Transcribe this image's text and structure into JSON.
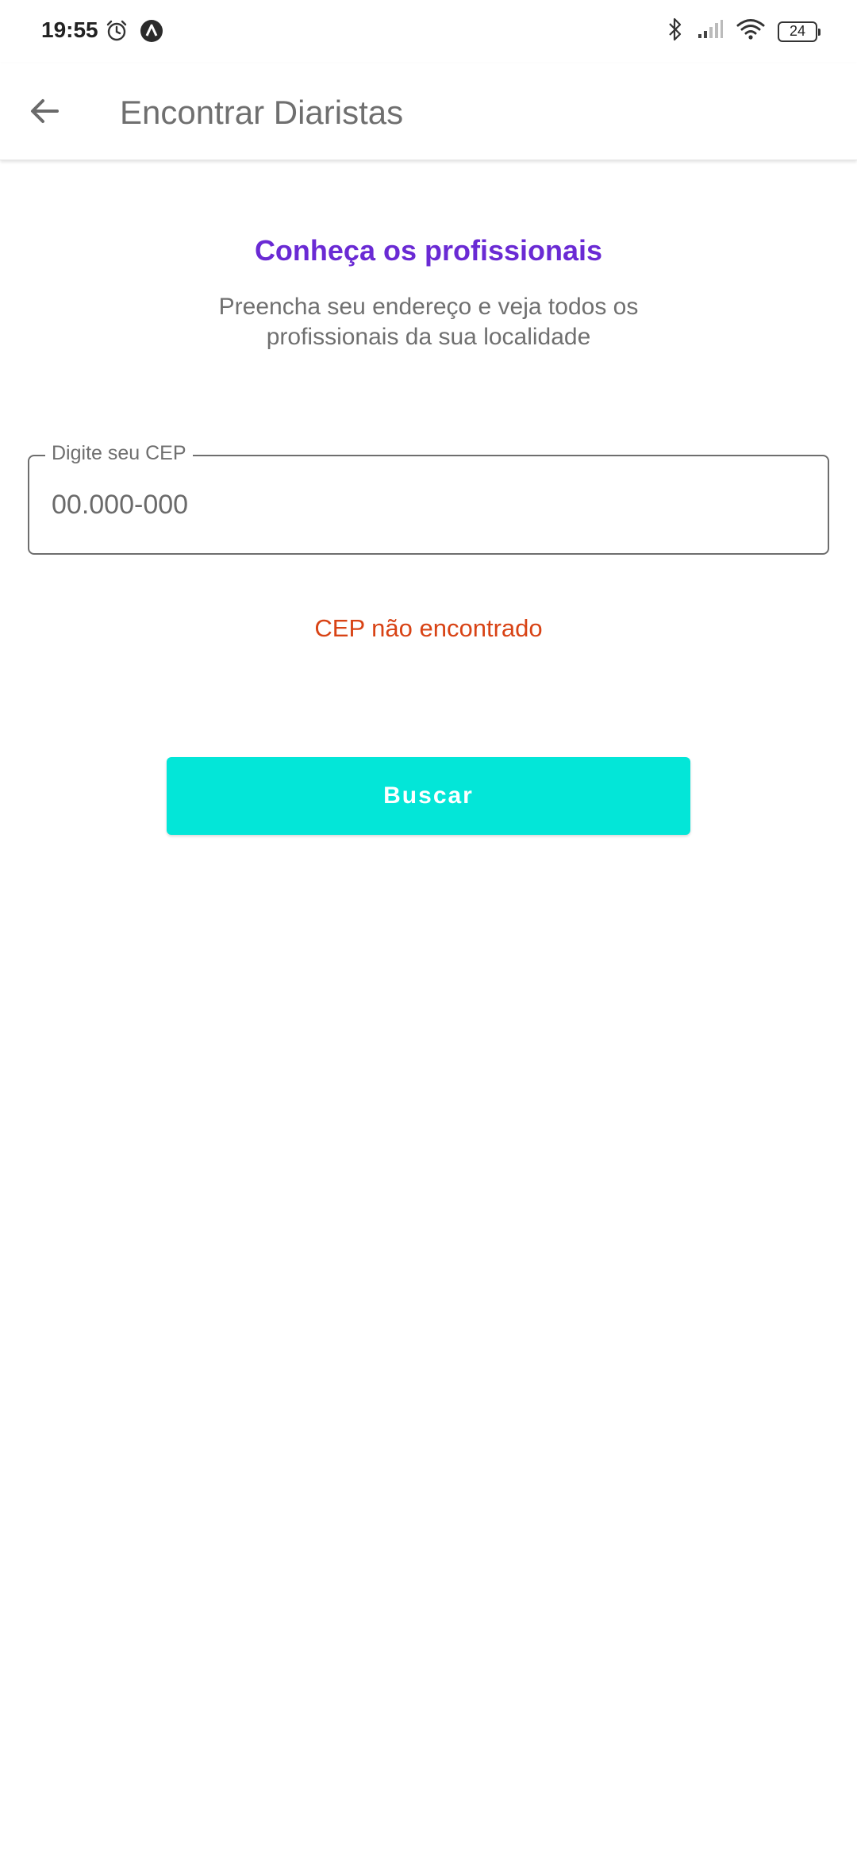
{
  "status_bar": {
    "time": "19:55",
    "battery_level": "24",
    "icons": [
      "alarm-icon",
      "app-notification-icon",
      "bluetooth-icon",
      "cell-signal-icon",
      "wifi-icon",
      "battery-icon"
    ]
  },
  "app_bar": {
    "title": "Encontrar Diaristas",
    "back_icon": "arrow-back-icon"
  },
  "content": {
    "heading": "Conheça os profissionais",
    "subtitle_line1": "Preencha seu endereço e veja todos os",
    "subtitle_line2": "profissionais da sua localidade"
  },
  "cep_field": {
    "label": "Digite seu CEP",
    "placeholder": "00.000-000",
    "value": ""
  },
  "error": {
    "message": "CEP não encontrado"
  },
  "search_button": {
    "label": "Buscar"
  },
  "colors": {
    "heading": "#6a2ad4",
    "error": "#d84315",
    "button": "#03e6d8"
  }
}
